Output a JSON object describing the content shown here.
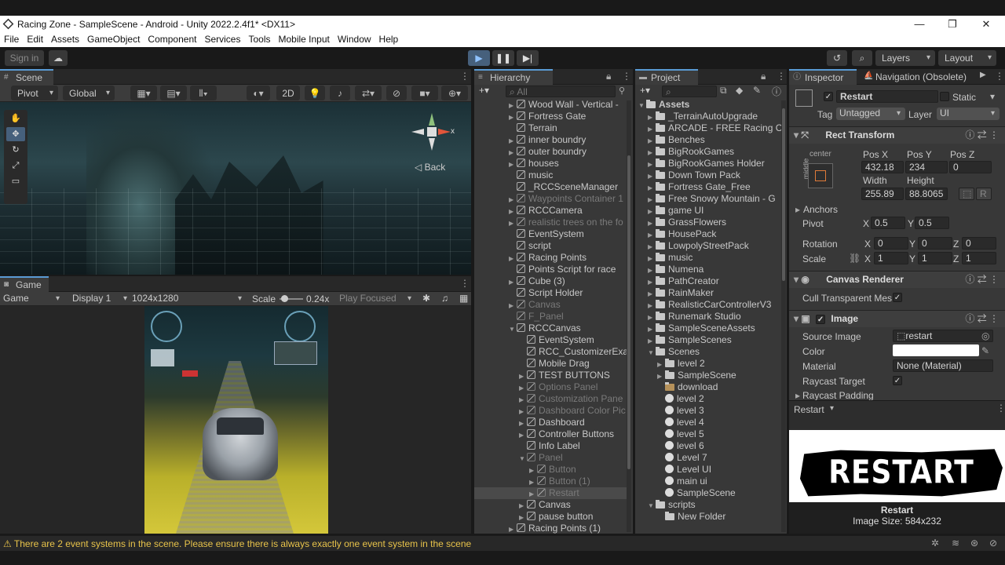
{
  "window": {
    "title": "Racing Zone - SampleScene - Android - Unity 2022.2.4f1* <DX11>"
  },
  "menu": [
    "File",
    "Edit",
    "Assets",
    "GameObject",
    "Component",
    "Services",
    "Tools",
    "Mobile Input",
    "Window",
    "Help"
  ],
  "toolbar": {
    "sign_in": "Sign in",
    "layers": "Layers",
    "layout": "Layout"
  },
  "scene": {
    "tab": "Scene",
    "pivot": "Pivot",
    "global": "Global",
    "mode_2d": "2D",
    "back_label": "◁ Back",
    "axis_x": "x"
  },
  "game": {
    "tab": "Game",
    "mode": "Game",
    "display": "Display 1",
    "resolution": "1024x1280",
    "scale_label": "Scale",
    "scale_value": "0.24x",
    "play_focused": "Play Focused"
  },
  "hierarchy": {
    "tab": "Hierarchy",
    "search_placeholder": "All",
    "items": [
      {
        "label": "Wood Wall - Vertical -",
        "indent": 0,
        "arrow": true,
        "dim": false
      },
      {
        "label": "Fortress Gate",
        "indent": 0,
        "arrow": true,
        "dim": false
      },
      {
        "label": "Terrain",
        "indent": 0,
        "arrow": false,
        "dim": false
      },
      {
        "label": "inner boundry",
        "indent": 0,
        "arrow": true,
        "dim": false
      },
      {
        "label": "outer boundry",
        "indent": 0,
        "arrow": true,
        "dim": false
      },
      {
        "label": "houses",
        "indent": 0,
        "arrow": true,
        "dim": false
      },
      {
        "label": "music",
        "indent": 0,
        "arrow": false,
        "dim": false
      },
      {
        "label": "_RCCSceneManager",
        "indent": 0,
        "arrow": false,
        "dim": false
      },
      {
        "label": "Waypoints Container 1",
        "indent": 0,
        "arrow": true,
        "dim": true
      },
      {
        "label": "RCCCamera",
        "indent": 0,
        "arrow": true,
        "dim": false
      },
      {
        "label": "realistic trees on the fo",
        "indent": 0,
        "arrow": true,
        "dim": true
      },
      {
        "label": "EventSystem",
        "indent": 0,
        "arrow": false,
        "dim": false
      },
      {
        "label": "script",
        "indent": 0,
        "arrow": false,
        "dim": false
      },
      {
        "label": "Racing Points",
        "indent": 0,
        "arrow": true,
        "dim": false
      },
      {
        "label": "Points Script for race",
        "indent": 0,
        "arrow": false,
        "dim": false
      },
      {
        "label": "Cube (3)",
        "indent": 0,
        "arrow": true,
        "dim": false
      },
      {
        "label": "Script Holder",
        "indent": 0,
        "arrow": false,
        "dim": false
      },
      {
        "label": "Canvas",
        "indent": 0,
        "arrow": true,
        "dim": true
      },
      {
        "label": "F_Panel",
        "indent": 0,
        "arrow": false,
        "dim": true
      },
      {
        "label": "RCCCanvas",
        "indent": 0,
        "arrow": "open",
        "dim": false
      },
      {
        "label": "EventSystem",
        "indent": 1,
        "arrow": false,
        "dim": false
      },
      {
        "label": "RCC_CustomizerExa",
        "indent": 1,
        "arrow": false,
        "dim": false
      },
      {
        "label": "Mobile Drag",
        "indent": 1,
        "arrow": false,
        "dim": false
      },
      {
        "label": "TEST BUTTONS",
        "indent": 1,
        "arrow": true,
        "dim": false
      },
      {
        "label": "Options Panel",
        "indent": 1,
        "arrow": true,
        "dim": true
      },
      {
        "label": "Customization Pane",
        "indent": 1,
        "arrow": true,
        "dim": true
      },
      {
        "label": "Dashboard Color Pic",
        "indent": 1,
        "arrow": true,
        "dim": true
      },
      {
        "label": "Dashboard",
        "indent": 1,
        "arrow": true,
        "dim": false
      },
      {
        "label": "Controller Buttons",
        "indent": 1,
        "arrow": true,
        "dim": false
      },
      {
        "label": "Info Label",
        "indent": 1,
        "arrow": false,
        "dim": false
      },
      {
        "label": "Panel",
        "indent": 1,
        "arrow": "open",
        "dim": true
      },
      {
        "label": "Button",
        "indent": 2,
        "arrow": true,
        "dim": true
      },
      {
        "label": "Button (1)",
        "indent": 2,
        "arrow": true,
        "dim": true
      },
      {
        "label": "Restart",
        "indent": 2,
        "arrow": true,
        "dim": true,
        "selected": true
      },
      {
        "label": "Canvas",
        "indent": 1,
        "arrow": true,
        "dim": false
      },
      {
        "label": "pause button",
        "indent": 1,
        "arrow": true,
        "dim": false
      },
      {
        "label": "Racing Points (1)",
        "indent": 0,
        "arrow": true,
        "dim": false
      }
    ]
  },
  "project": {
    "tab": "Project",
    "items": [
      {
        "label": "Assets",
        "type": "folder",
        "indent": 0,
        "arrow": "open"
      },
      {
        "label": "_TerrainAutoUpgrade",
        "type": "folder",
        "indent": 1,
        "arrow": true
      },
      {
        "label": "ARCADE - FREE Racing C",
        "type": "folder",
        "indent": 1,
        "arrow": true
      },
      {
        "label": "Benches",
        "type": "folder",
        "indent": 1,
        "arrow": true
      },
      {
        "label": "BigRookGames",
        "type": "folder",
        "indent": 1,
        "arrow": true
      },
      {
        "label": "BigRookGames Holder",
        "type": "folder",
        "indent": 1,
        "arrow": true
      },
      {
        "label": "Down Town Pack",
        "type": "folder",
        "indent": 1,
        "arrow": true
      },
      {
        "label": "Fortress Gate_Free",
        "type": "folder",
        "indent": 1,
        "arrow": true
      },
      {
        "label": "Free Snowy Mountain - G",
        "type": "folder",
        "indent": 1,
        "arrow": true
      },
      {
        "label": "game UI",
        "type": "folder",
        "indent": 1,
        "arrow": true
      },
      {
        "label": "GrassFlowers",
        "type": "folder",
        "indent": 1,
        "arrow": true
      },
      {
        "label": "HousePack",
        "type": "folder",
        "indent": 1,
        "arrow": true
      },
      {
        "label": "LowpolyStreetPack",
        "type": "folder",
        "indent": 1,
        "arrow": true
      },
      {
        "label": "music",
        "type": "folder",
        "indent": 1,
        "arrow": true
      },
      {
        "label": "Numena",
        "type": "folder",
        "indent": 1,
        "arrow": true
      },
      {
        "label": "PathCreator",
        "type": "folder",
        "indent": 1,
        "arrow": true
      },
      {
        "label": "RainMaker",
        "type": "folder",
        "indent": 1,
        "arrow": true
      },
      {
        "label": "RealisticCarControllerV3",
        "type": "folder",
        "indent": 1,
        "arrow": true
      },
      {
        "label": "Runemark Studio",
        "type": "folder",
        "indent": 1,
        "arrow": true
      },
      {
        "label": "SampleSceneAssets",
        "type": "folder",
        "indent": 1,
        "arrow": true
      },
      {
        "label": "SampleScenes",
        "type": "folder",
        "indent": 1,
        "arrow": true
      },
      {
        "label": "Scenes",
        "type": "folder",
        "indent": 1,
        "arrow": "open"
      },
      {
        "label": "level 2",
        "type": "folder",
        "indent": 2,
        "arrow": true
      },
      {
        "label": "SampleScene",
        "type": "folder",
        "indent": 2,
        "arrow": true
      },
      {
        "label": "download",
        "type": "image",
        "indent": 2,
        "arrow": false
      },
      {
        "label": "level 2",
        "type": "scene",
        "indent": 2,
        "arrow": false
      },
      {
        "label": "level 3",
        "type": "scene",
        "indent": 2,
        "arrow": false
      },
      {
        "label": "level 4",
        "type": "scene",
        "indent": 2,
        "arrow": false
      },
      {
        "label": "level 5",
        "type": "scene",
        "indent": 2,
        "arrow": false
      },
      {
        "label": "level 6",
        "type": "scene",
        "indent": 2,
        "arrow": false
      },
      {
        "label": "Level 7",
        "type": "scene",
        "indent": 2,
        "arrow": false
      },
      {
        "label": "Level UI",
        "type": "scene",
        "indent": 2,
        "arrow": false
      },
      {
        "label": "main ui",
        "type": "scene",
        "indent": 2,
        "arrow": false
      },
      {
        "label": "SampleScene",
        "type": "scene",
        "indent": 2,
        "arrow": false
      },
      {
        "label": "scripts",
        "type": "folder",
        "indent": 1,
        "arrow": "open"
      },
      {
        "label": "New Folder",
        "type": "folder",
        "indent": 2,
        "arrow": false
      }
    ]
  },
  "inspector": {
    "tab": "Inspector",
    "tab2": "Navigation (Obsolete)",
    "object_name": "Restart",
    "static_label": "Static",
    "tag_label": "Tag",
    "tag_value": "Untagged",
    "layer_label": "Layer",
    "layer_value": "UI",
    "rect_transform": {
      "title": "Rect Transform",
      "anchor_h": "center",
      "anchor_v": "middle",
      "posx_label": "Pos X",
      "posx": "432.18",
      "posy_label": "Pos Y",
      "posy": "234",
      "posz_label": "Pos Z",
      "posz": "0",
      "width_label": "Width",
      "width": "255.89",
      "height_label": "Height",
      "height": "88.8065",
      "r_btn": "R",
      "anchors_label": "Anchors",
      "pivot_label": "Pivot",
      "pivot_x": "0.5",
      "pivot_y": "0.5",
      "rotation_label": "Rotation",
      "rot_x": "0",
      "rot_y": "0",
      "rot_z": "0",
      "scale_label": "Scale",
      "scale_x": "1",
      "scale_y": "1",
      "scale_z": "1",
      "x_label": "X",
      "y_label": "Y",
      "z_label": "Z"
    },
    "canvas_renderer": {
      "title": "Canvas Renderer",
      "cull_label": "Cull Transparent Mes"
    },
    "image": {
      "title": "Image",
      "source_label": "Source Image",
      "source_value": "restart",
      "color_label": "Color",
      "material_label": "Material",
      "material_value": "None (Material)",
      "raycast_label": "Raycast Target",
      "raycast_padding": "Raycast Padding"
    },
    "preview_dropdown": "Restart",
    "preview_image_text": "RESTART",
    "preview_name": "Restart",
    "preview_size": "Image Size: 584x232"
  },
  "status": {
    "message": "There are 2 event systems in the scene. Please ensure there is always exactly one event system in the scene"
  }
}
